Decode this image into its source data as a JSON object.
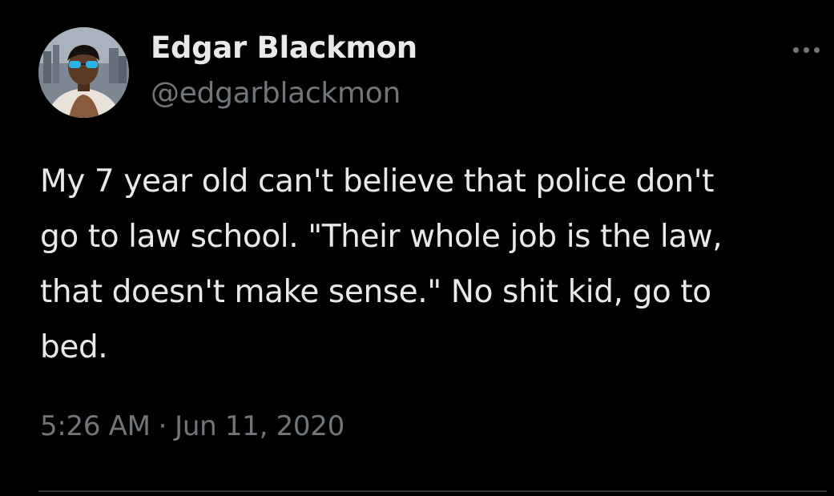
{
  "author": {
    "display_name": "Edgar Blackmon",
    "handle": "@edgarblackmon"
  },
  "more_menu": {
    "icon": "more-horizontal-icon"
  },
  "tweet": {
    "text_lines": [
      "My 7 year old can't believe that police don't",
      "go to law school. \"Their whole job is the law,",
      "that doesn't make sense.\" No shit kid, go to",
      "bed."
    ],
    "time": "5:26 AM",
    "separator": "·",
    "date": "Jun 11, 2020"
  },
  "colors": {
    "background": "#000000",
    "primary_text": "#e7e9ea",
    "secondary_text": "#71767b",
    "divider": "#2f3336"
  }
}
